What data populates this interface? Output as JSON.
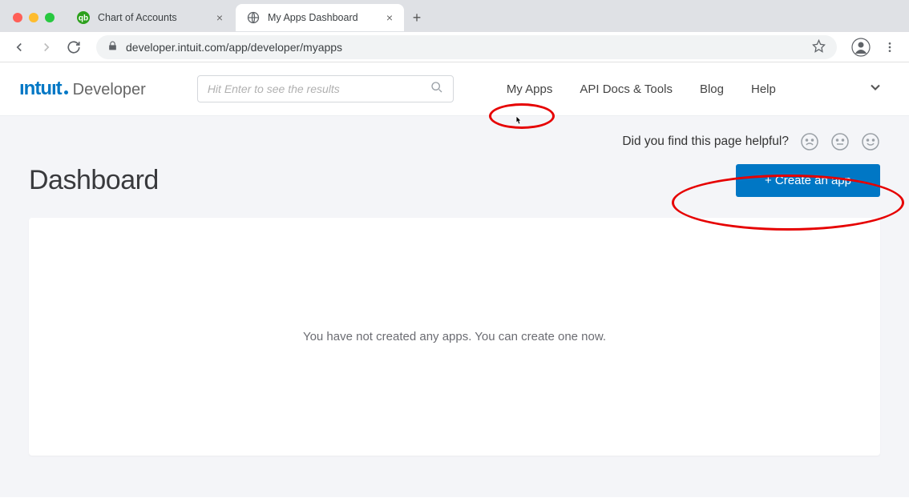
{
  "browser": {
    "tabs": [
      {
        "title": "Chart of Accounts",
        "active": false
      },
      {
        "title": "My Apps Dashboard",
        "active": true
      }
    ],
    "url": "developer.intuit.com/app/developer/myapps"
  },
  "header": {
    "logo_brand": "ıntuıt",
    "logo_sub": "Developer",
    "search_placeholder": "Hit Enter to see the results",
    "nav": {
      "my_apps": "My Apps",
      "api_docs": "API Docs & Tools",
      "blog": "Blog",
      "help": "Help"
    }
  },
  "content": {
    "helpful_prompt": "Did you find this page helpful?",
    "title": "Dashboard",
    "create_app_label": "+ Create an app",
    "empty_state": "You have not created any apps. You can create one now."
  }
}
